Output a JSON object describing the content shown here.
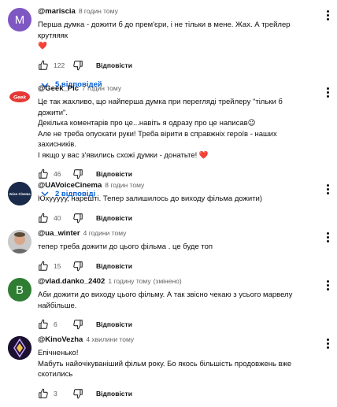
{
  "comments": [
    {
      "avatar_letter": "M",
      "avatar_color": "#7e57c2",
      "author": "@mariscia",
      "time": "8 годин тому",
      "lines": [
        "Перша думка - дожити б до прем'єри, і не тільки в мене. Жах. А трейлер крутяяяк"
      ],
      "heart": "❤️",
      "likes": "122",
      "reply_label": "Відповісти",
      "replies_label": "5 відповідей"
    },
    {
      "avatar_icon": "geek-pic-avatar",
      "avatar_text": "Geek",
      "avatar_color": "#e53935",
      "author": "@Geek_Pic",
      "time": "7 годин тому",
      "lines": [
        "Це так жахливо, що найперша думка при перегляді трейлеру \"тільки б дожити\".",
        "Декілька коментарів про це...навіть я одразу про це написав😉",
        "Але не треба опускати руки! Треба вірити в справжніх героїв - наших  захисників.",
        "І якщо у вас з'явились схожі думки - донатьте! ❤️"
      ],
      "likes": "46",
      "reply_label": "Відповісти",
      "replies_label": "2 відповіді"
    },
    {
      "avatar_icon": "ua-voice-cinema-avatar",
      "avatar_text": "Voice Cinema",
      "avatar_color": "#1a2a4a",
      "author": "@UAVoiceCinema",
      "time": "8 годин тому",
      "lines": [
        "Юхууууу, нарешті. Тепер залишилось до виходу фільма дожити)"
      ],
      "likes": "40",
      "reply_label": "Відповісти"
    },
    {
      "avatar_icon": "ua-winter-avatar",
      "avatar_color": "#8d8d8d",
      "author": "@ua_winter",
      "time": "4 години тому",
      "lines": [
        "тепер треба дожити до цього фільма . це буде топ"
      ],
      "likes": "15",
      "reply_label": "Відповісти"
    },
    {
      "avatar_letter": "B",
      "avatar_color": "#2e7d32",
      "author": "@vlad.danko_2402",
      "time": "1 годину тому",
      "edited": "(змінено)",
      "lines": [
        "Аби дожити до виходу цього фільму. А так звісно чекаю з усього марвелу",
        "найбільше."
      ],
      "likes": "6",
      "reply_label": "Відповісти"
    },
    {
      "avatar_icon": "kinovezha-avatar",
      "avatar_color": "#1b1030",
      "author": "@KinoVezha",
      "time": "4 хвилини тому",
      "lines": [
        "Епічненько!",
        "Мабуть найочікуваніший фільм року. Бо якось більшість продовжень вже",
        "скотились"
      ],
      "likes": "3",
      "reply_label": "Відповісти"
    }
  ]
}
